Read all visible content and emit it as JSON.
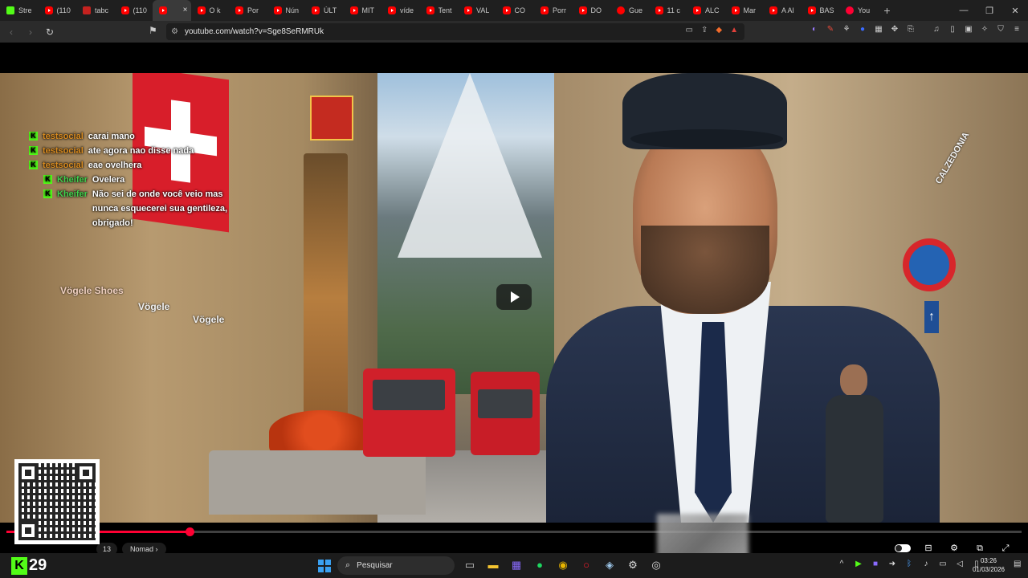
{
  "browser": {
    "tabs": [
      {
        "label": "Stre",
        "icon": "kick"
      },
      {
        "label": "(110",
        "icon": "yt"
      },
      {
        "label": "tabc",
        "icon": "gmail"
      },
      {
        "label": "(110",
        "icon": "yt"
      },
      {
        "label": "",
        "icon": "yt",
        "active": true
      },
      {
        "label": "O k",
        "icon": "yt"
      },
      {
        "label": "Por",
        "icon": "yt"
      },
      {
        "label": "Nún",
        "icon": "yt"
      },
      {
        "label": "ÚLT",
        "icon": "yt"
      },
      {
        "label": "MIT",
        "icon": "yt"
      },
      {
        "label": "víde",
        "icon": "yt"
      },
      {
        "label": "Tent",
        "icon": "yt"
      },
      {
        "label": "VAL",
        "icon": "yt"
      },
      {
        "label": "CO",
        "icon": "yt"
      },
      {
        "label": "Porr",
        "icon": "yt"
      },
      {
        "label": "DO",
        "icon": "yt"
      },
      {
        "label": "Gue",
        "icon": "ytc"
      },
      {
        "label": "11 c",
        "icon": "yt"
      },
      {
        "label": "ALC",
        "icon": "yt"
      },
      {
        "label": "Mar",
        "icon": "yt"
      },
      {
        "label": "A Al",
        "icon": "yt"
      },
      {
        "label": "BAS",
        "icon": "yt"
      },
      {
        "label": "You",
        "icon": "music"
      }
    ],
    "tab_close_glyph": "×",
    "new_tab_glyph": "+",
    "url": "youtube.com/watch?v=Sge8SeRMRUk"
  },
  "video": {
    "chat": [
      {
        "user": "testsocial",
        "message": "carai mano",
        "color": "orange",
        "reply": false
      },
      {
        "user": "testsocial",
        "message": "ate agora nao disse nada",
        "color": "orange",
        "reply": false
      },
      {
        "user": "testsocial",
        "message": "eae ovelhera",
        "color": "orange",
        "reply": false
      },
      {
        "user": "Kheifer",
        "message": "Ovelera",
        "color": "green",
        "reply": true
      },
      {
        "user": "Kheifer",
        "message": "Não sei de onde você veio mas nunca esquecerei sua gentileza, obrigado!",
        "color": "green",
        "reply": true
      }
    ],
    "scene_text": {
      "store_left": "Vögele Shoes",
      "store_left2": "Vögele",
      "store_left3": "Vögele",
      "store_right": "CALZEDONIA"
    },
    "progress_fraction": 0.18,
    "time_label": "13",
    "chapter_label": "Nomad",
    "chapter_chevron": "›"
  },
  "taskbar": {
    "kick_count": "29",
    "search_placeholder": "Pesquisar",
    "time": "03:26",
    "date": "01/03/2026"
  },
  "colors": {
    "youtube_red": "#ff0033",
    "kick_green": "#53fc18",
    "chat_orange": "#d98b1f",
    "chat_green": "#41d14d"
  }
}
